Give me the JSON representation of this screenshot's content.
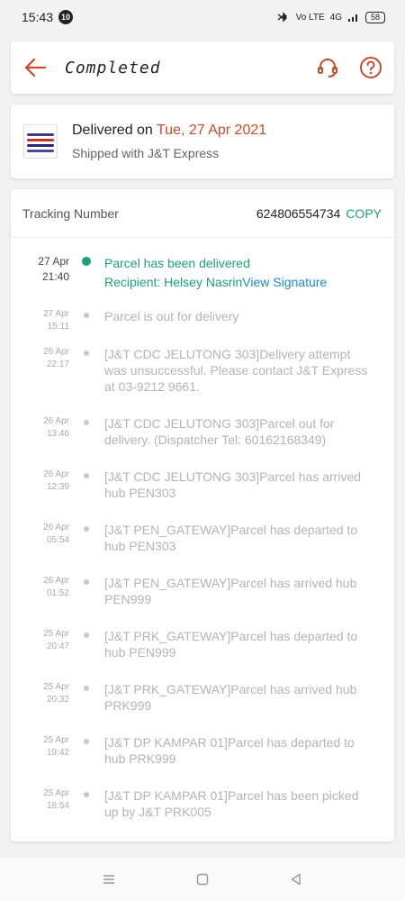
{
  "status_bar": {
    "time": "15:43",
    "notification_count": "10",
    "network": "Vo LTE",
    "signal": "4G",
    "battery": "58"
  },
  "header": {
    "title": "Completed",
    "back_icon": "arrow-left-icon",
    "support_icon": "headset-icon",
    "help_icon": "question-circle-icon",
    "accent_color": "#d2492a"
  },
  "delivery": {
    "delivered_prefix": "Delivered on ",
    "delivered_date": "Tue, 27 Apr 2021",
    "shipped_with": "Shipped with J&T Express"
  },
  "tracking": {
    "label": "Tracking Number",
    "number": "624806554734",
    "copy_label": "COPY",
    "events": [
      {
        "date": "27 Apr",
        "time": "21:40",
        "text": "Parcel has been delivered",
        "recipient": "Recipient: Helsey Nasrin",
        "link": "View Signature"
      },
      {
        "date": "27 Apr",
        "time": "15:11",
        "text": "Parcel is out for delivery"
      },
      {
        "date": "26 Apr",
        "time": "22:17",
        "text": "[J&T CDC JELUTONG 303]Delivery attempt was unsuccessful. Please contact J&T Express at 03-9212 9661."
      },
      {
        "date": "26 Apr",
        "time": "13:46",
        "text": "[J&T CDC JELUTONG 303]Parcel out for delivery. (Dispatcher Tel: 60162168349)"
      },
      {
        "date": "26 Apr",
        "time": "12:39",
        "text": "[J&T CDC JELUTONG 303]Parcel has arrived hub PEN303"
      },
      {
        "date": "26 Apr",
        "time": "05:54",
        "text": "[J&T PEN_GATEWAY]Parcel has departed to hub PEN303"
      },
      {
        "date": "26 Apr",
        "time": "01:52",
        "text": "[J&T PEN_GATEWAY]Parcel has arrived hub PEN999"
      },
      {
        "date": "25 Apr",
        "time": "20:47",
        "text": "[J&T PRK_GATEWAY]Parcel has departed to hub PEN999"
      },
      {
        "date": "25 Apr",
        "time": "20:32",
        "text": "[J&T PRK_GATEWAY]Parcel has arrived hub PRK999"
      },
      {
        "date": "25 Apr",
        "time": "19:42",
        "text": "[J&T DP KAMPAR 01]Parcel has departed to hub PRK999"
      },
      {
        "date": "25 Apr",
        "time": "18:54",
        "text": "[J&T DP KAMPAR 01]Parcel has been picked up by J&T PRK005"
      }
    ],
    "status_color": "#1aa37a",
    "link_color": "#1a8cc7"
  },
  "nav_bar": {
    "menu_icon": "menu-icon",
    "home_icon": "square-home-icon",
    "back_icon": "triangle-back-icon"
  }
}
